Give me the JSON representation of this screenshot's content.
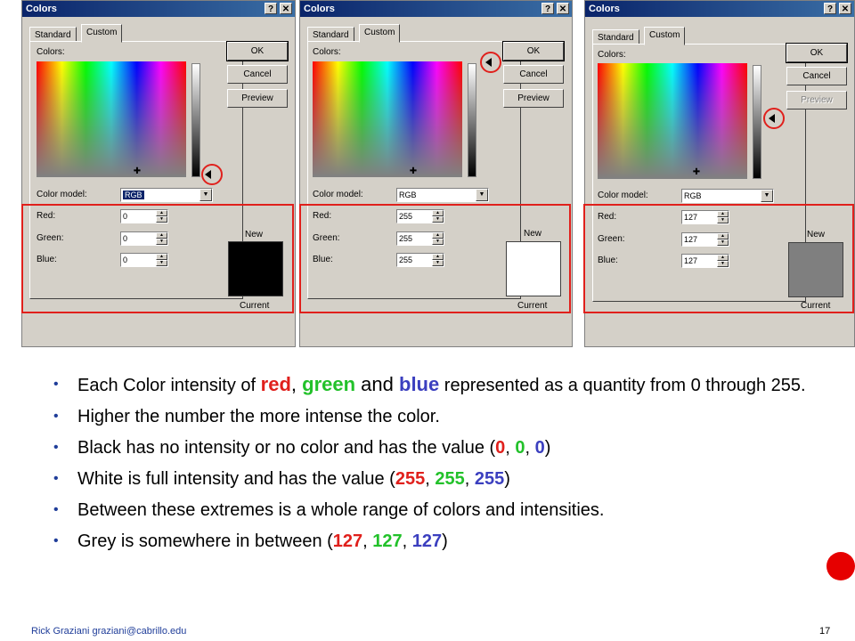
{
  "dialogs": [
    {
      "title": "Colors",
      "tabs": [
        "Standard",
        "Custom"
      ],
      "active_tab": "Custom",
      "colors_label": "Colors:",
      "color_model_label": "Color model:",
      "color_model_value": "RGB",
      "red_label": "Red:",
      "green_label": "Green:",
      "blue_label": "Blue:",
      "red": "0",
      "green": "0",
      "blue": "0",
      "ok_label": "OK",
      "cancel_label": "Cancel",
      "preview_label": "Preview",
      "new_label": "New",
      "current_label": "Current",
      "swatch_color": "#000000",
      "luminance_level": 0.0
    },
    {
      "title": "Colors",
      "tabs": [
        "Standard",
        "Custom"
      ],
      "active_tab": "Custom",
      "colors_label": "Colors:",
      "color_model_label": "Color model:",
      "color_model_value": "RGB",
      "red_label": "Red:",
      "green_label": "Green:",
      "blue_label": "Blue:",
      "red": "255",
      "green": "255",
      "blue": "255",
      "ok_label": "OK",
      "cancel_label": "Cancel",
      "preview_label": "Preview",
      "new_label": "New",
      "current_label": "Current",
      "swatch_color": "#ffffff",
      "luminance_level": 1.0
    },
    {
      "title": "Colors",
      "tabs": [
        "Standard",
        "Custom"
      ],
      "active_tab": "Custom",
      "colors_label": "Colors:",
      "color_model_label": "Color model:",
      "color_model_value": "RGB",
      "red_label": "Red:",
      "green_label": "Green:",
      "blue_label": "Blue:",
      "red": "127",
      "green": "127",
      "blue": "127",
      "ok_label": "OK",
      "cancel_label": "Cancel",
      "preview_label": "Preview",
      "new_label": "New",
      "current_label": "Current",
      "swatch_color": "#7f7f7f",
      "luminance_level": 0.5
    }
  ],
  "bullets": {
    "b1_prefix": "Each Color intensity of ",
    "b1_red": "red",
    "b1_comma": ", ",
    "b1_green": "green",
    "b1_and": " and ",
    "b1_blue": "blue",
    "b1_suffix": " represented as a quantity from 0 through 255.",
    "b2": "Higher the number the more intense the color.",
    "b3_prefix": "Black has no intensity or no color and has the value (",
    "b3_r": "0",
    "b3_g": "0",
    "b3_b": "0",
    "b4_prefix": "White is full intensity and has the value (",
    "b4_r": "255",
    "b4_g": "255",
    "b4_b": "255",
    "b5": "Between these extremes is a whole range of colors and intensities.",
    "b6_prefix": "Grey is somewhere in between (",
    "b6_r": "127",
    "b6_g": "127",
    "b6_b": "127",
    "sep": ", ",
    "close": ")"
  },
  "footer": {
    "author": "Rick Graziani  graziani@cabrillo.edu",
    "page": "17"
  },
  "colors": {
    "highlight_red": "#e0201c",
    "accent_green": "#22c12a",
    "accent_blue": "#3b3fbf",
    "bullet_color": "#1f3d99"
  }
}
